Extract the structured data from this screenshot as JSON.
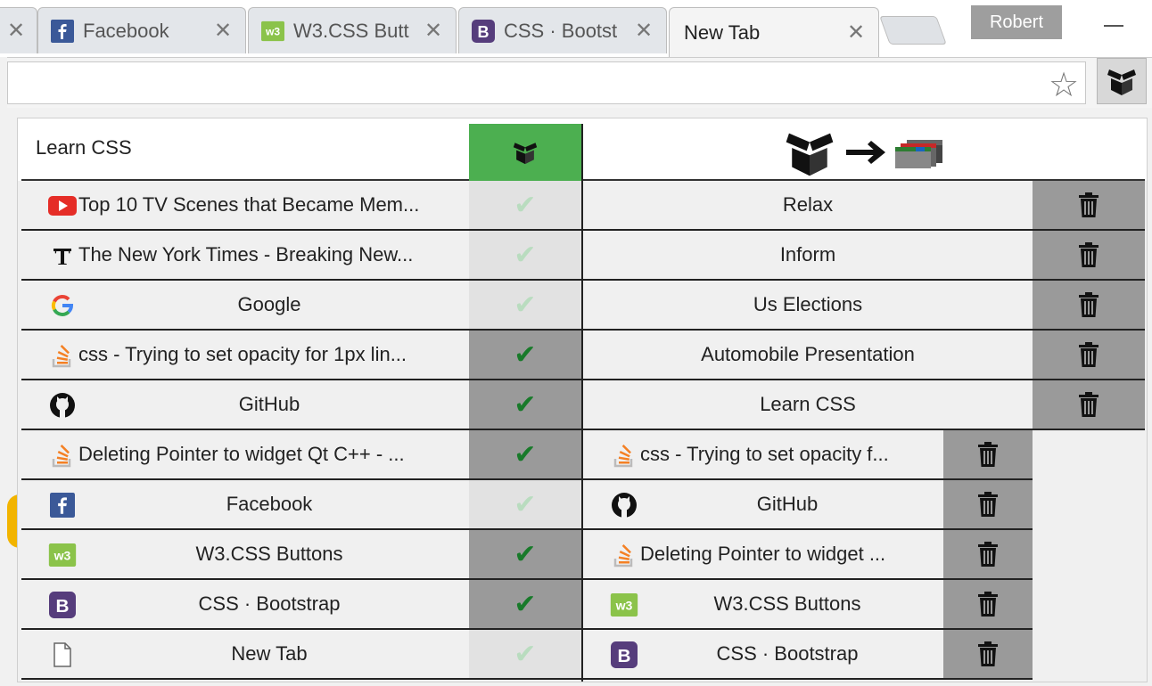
{
  "browser": {
    "tabs": [
      {
        "title": "Facebook",
        "icon": "facebook-icon",
        "close": "✕"
      },
      {
        "title": "W3.CSS Butt",
        "icon": "w3css-icon",
        "close": "✕"
      },
      {
        "title": "CSS · Bootst",
        "icon": "bootstrap-icon",
        "close": "✕"
      },
      {
        "title": "New Tab",
        "icon": "none",
        "close": "✕",
        "active": true
      }
    ],
    "partial_tab_close": "✕",
    "profile_name": "Robert",
    "bookmark_star": "☆"
  },
  "popup": {
    "header_title": "Learn CSS",
    "accent_green": "#4caf50",
    "tabs": [
      {
        "title": "Top 10 TV Scenes that Became Mem...",
        "icon": "youtube-icon",
        "checked": false
      },
      {
        "title": "The New York Times - Breaking New...",
        "icon": "nytimes-icon",
        "checked": false
      },
      {
        "title": "Google",
        "icon": "google-icon",
        "checked": false
      },
      {
        "title": "css - Trying to set opacity for 1px lin...",
        "icon": "stackoverflow-icon",
        "checked": true
      },
      {
        "title": "GitHub",
        "icon": "github-icon",
        "checked": true
      },
      {
        "title": "Deleting Pointer to widget Qt C++ - ...",
        "icon": "stackoverflow-icon",
        "checked": true
      },
      {
        "title": "Facebook",
        "icon": "facebook-icon",
        "checked": false
      },
      {
        "title": "W3.CSS Buttons",
        "icon": "w3css-icon",
        "checked": true
      },
      {
        "title": "CSS · Bootstrap",
        "icon": "bootstrap-icon",
        "checked": true
      },
      {
        "title": "New Tab",
        "icon": "page-icon",
        "checked": false
      }
    ],
    "check_glyph": "✔",
    "groups": [
      "Relax",
      "Inform",
      "Us Elections",
      "Automobile Presentation",
      "Learn CSS"
    ],
    "group_items": [
      {
        "title": "css - Trying to set opacity f...",
        "icon": "stackoverflow-icon"
      },
      {
        "title": "GitHub",
        "icon": "github-icon"
      },
      {
        "title": "Deleting Pointer to widget ...",
        "icon": "stackoverflow-icon"
      },
      {
        "title": "W3.CSS Buttons",
        "icon": "w3css-icon"
      },
      {
        "title": "CSS · Bootstrap",
        "icon": "bootstrap-icon"
      }
    ]
  }
}
